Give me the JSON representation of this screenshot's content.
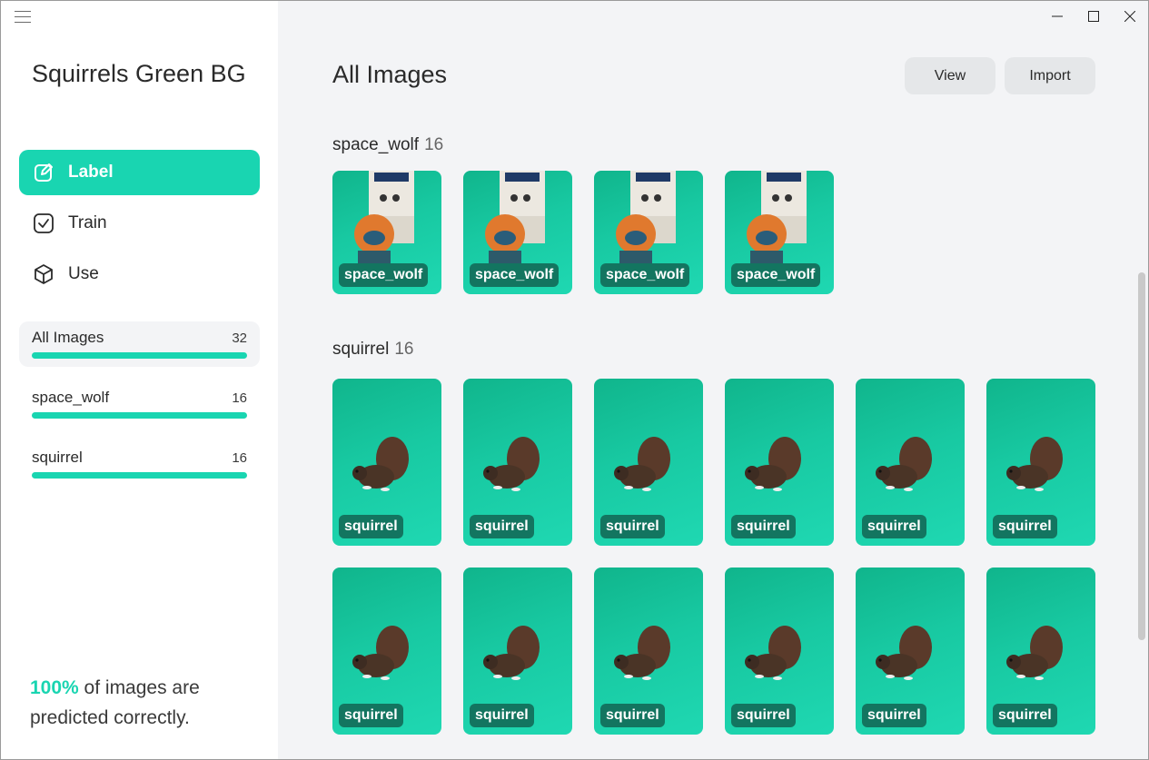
{
  "sidebar": {
    "project_title": "Squirrels Green BG",
    "nav": [
      {
        "label": "Label",
        "icon": "edit-icon",
        "active": true
      },
      {
        "label": "Train",
        "icon": "checkbox-icon",
        "active": false
      },
      {
        "label": "Use",
        "icon": "cube-icon",
        "active": false
      }
    ],
    "filters": [
      {
        "label": "All Images",
        "count": "32",
        "active": true
      },
      {
        "label": "space_wolf",
        "count": "16",
        "active": false
      },
      {
        "label": "squirrel",
        "count": "16",
        "active": false
      }
    ],
    "accuracy": {
      "percent": "100%",
      "text": " of images are predicted correctly."
    }
  },
  "main": {
    "title": "All Images",
    "buttons": {
      "view": "View",
      "import": "Import"
    },
    "sections": [
      {
        "label": "space_wolf",
        "count": "16",
        "tags": [
          "space_wolf",
          "space_wolf",
          "space_wolf",
          "space_wolf"
        ]
      },
      {
        "label": "squirrel",
        "count": "16",
        "tags": [
          "squirrel",
          "squirrel",
          "squirrel",
          "squirrel",
          "squirrel",
          "squirrel",
          "squirrel",
          "squirrel",
          "squirrel",
          "squirrel",
          "squirrel",
          "squirrel"
        ]
      }
    ]
  },
  "colors": {
    "accent": "#19d5b1",
    "tag_bg": "#137560",
    "sidebar_bg": "#ffffff",
    "main_bg": "#f3f4f6"
  }
}
